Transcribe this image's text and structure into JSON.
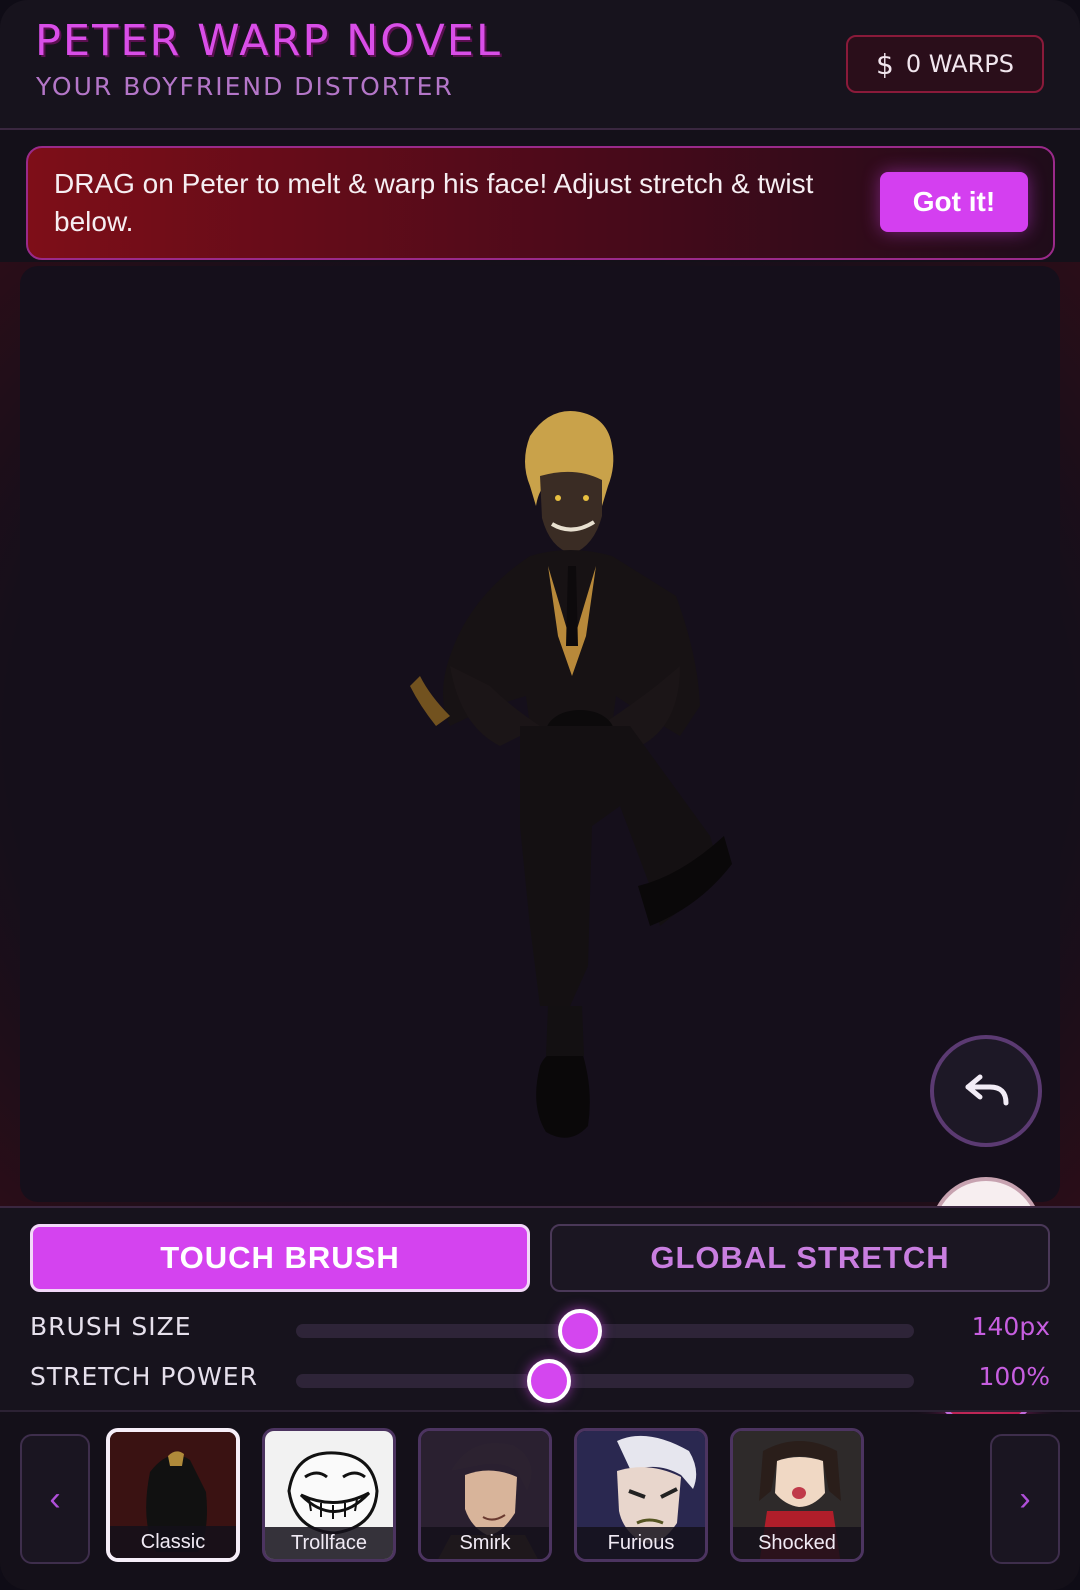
{
  "header": {
    "title": "PETER WARP NOVEL",
    "subtitle": "YOUR BOYFRIEND DISTORTER",
    "warps_icon": "$",
    "warps_label": "0 WARPS"
  },
  "banner": {
    "text": "DRAG on Peter to melt & warp his face! Adjust stretch & twist below.",
    "button_label": "Got it!"
  },
  "canvas": {
    "actions": [
      {
        "name": "undo",
        "icon": "undo-icon"
      },
      {
        "name": "reset",
        "icon": "refresh-icon"
      },
      {
        "name": "snapshot",
        "icon": "camera-icon"
      }
    ]
  },
  "modes": {
    "touch_brush": "TOUCH BRUSH",
    "global_stretch": "GLOBAL STRETCH",
    "active": "touch_brush"
  },
  "sliders": {
    "brush_size": {
      "label": "BRUSH SIZE",
      "value": "140px",
      "fraction": 0.46
    },
    "stretch_power": {
      "label": "STRETCH POWER",
      "value": "100%",
      "fraction": 0.41
    }
  },
  "presets": {
    "prev_icon": "‹",
    "next_icon": "›",
    "items": [
      {
        "label": "Classic",
        "selected": true
      },
      {
        "label": "Trollface",
        "selected": false
      },
      {
        "label": "Smirk",
        "selected": false
      },
      {
        "label": "Furious",
        "selected": false
      },
      {
        "label": "Shocked",
        "selected": false
      }
    ]
  },
  "colors": {
    "accent": "#d443ef",
    "banner_red": "#7e0e18",
    "camera_red": "#a8123f"
  }
}
